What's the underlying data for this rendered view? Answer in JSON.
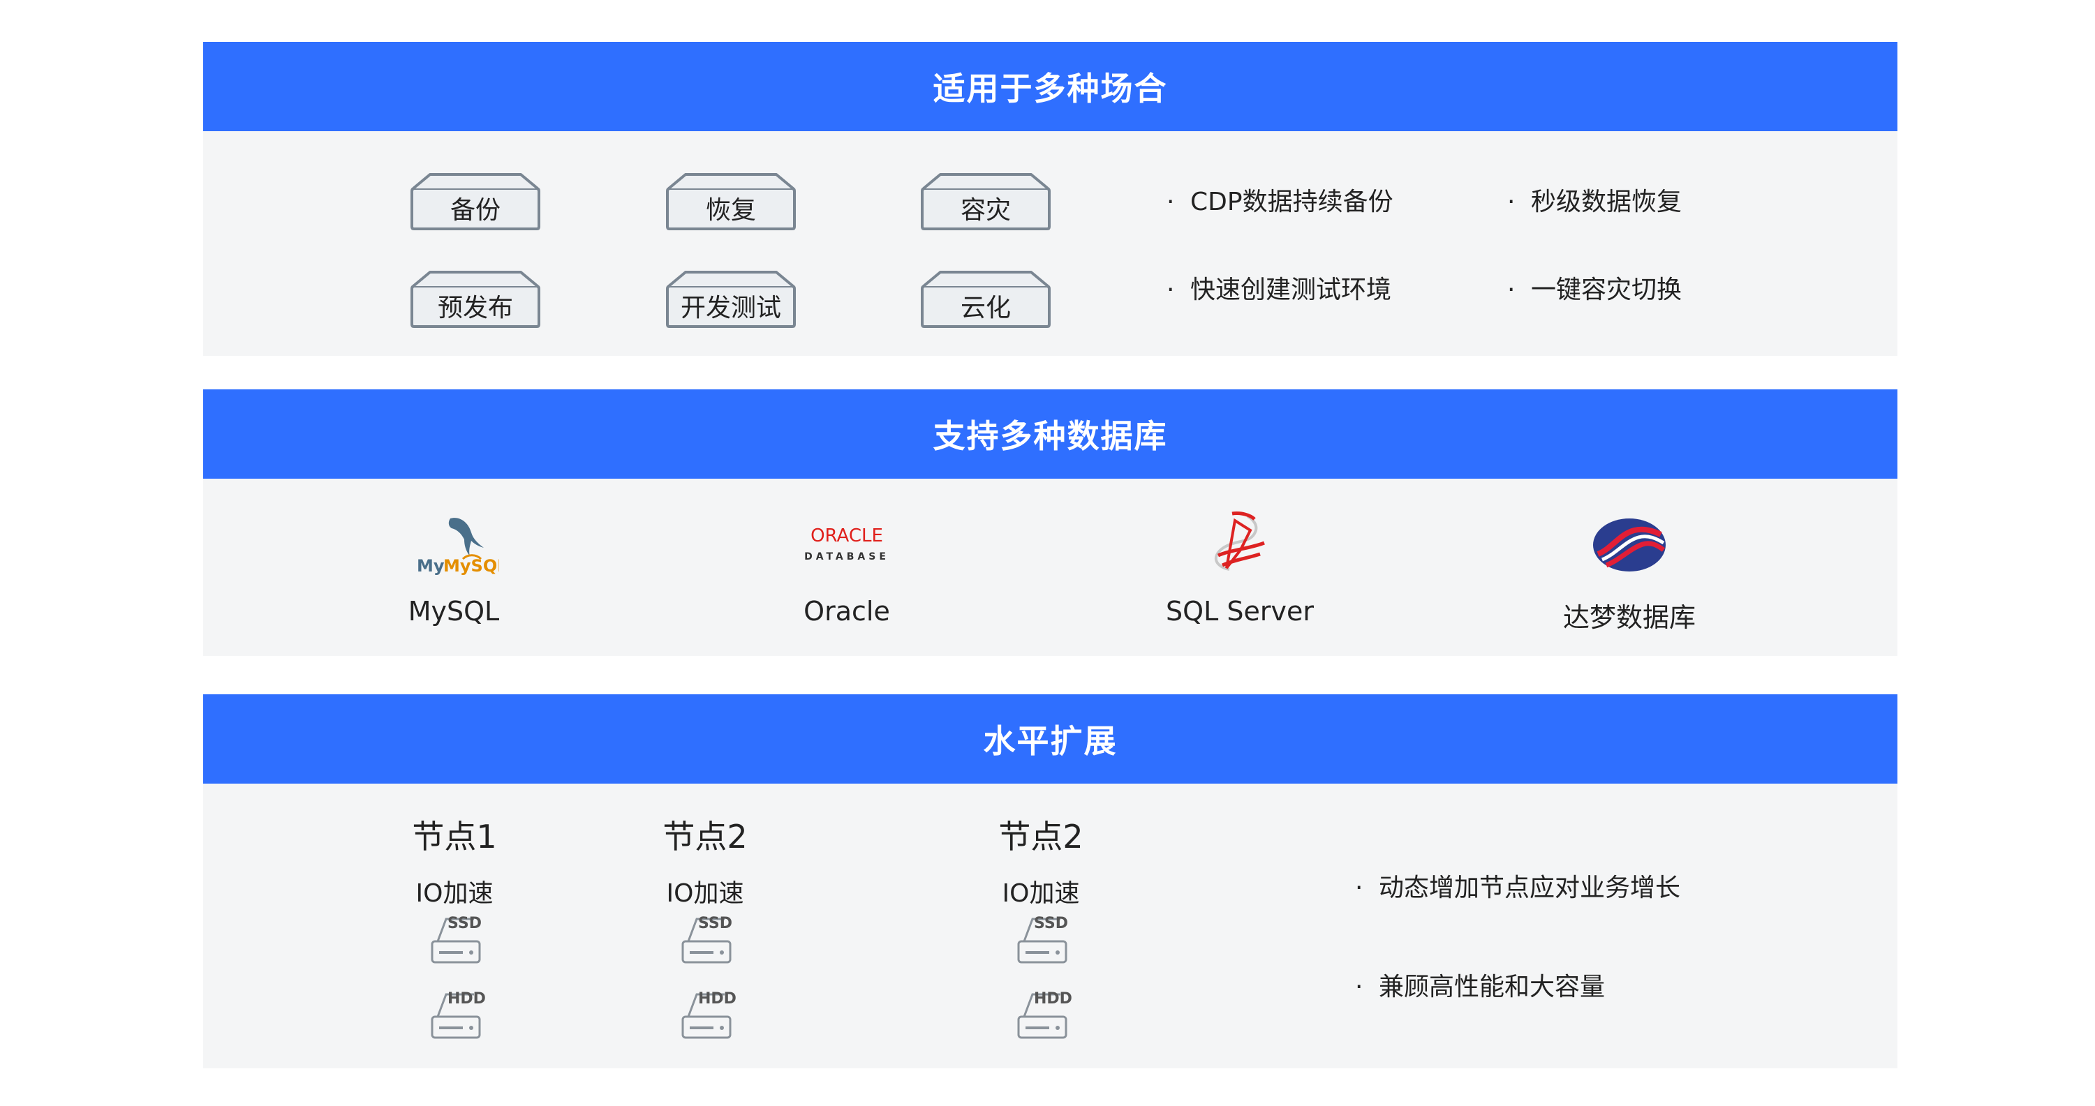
{
  "sections": {
    "scenarios": {
      "title": "适用于多种场合",
      "trays": [
        "备份",
        "恢复",
        "容灾",
        "预发布",
        "开发测试",
        "云化"
      ],
      "bullets": [
        "CDP数据持续备份",
        "秒级数据恢复",
        "快速创建测试环境",
        "一键容灾切换"
      ],
      "bullet_dot": "·"
    },
    "databases": {
      "title": "支持多种数据库",
      "items": [
        {
          "name": "MySQL",
          "logo_icon": "mysql-dolphin-icon",
          "logo_text": "MySQL"
        },
        {
          "name": "Oracle",
          "logo_icon": "oracle-logo-icon",
          "logo_text": "ORACLE",
          "logo_subtext": "DATABASE"
        },
        {
          "name": "SQL Server",
          "logo_icon": "sql-server-logo-icon"
        },
        {
          "name": "达梦数据库",
          "logo_icon": "dameng-logo-icon"
        }
      ]
    },
    "scaling": {
      "title": "水平扩展",
      "nodes": [
        {
          "title": "节点1",
          "sub": "IO加速",
          "drives": [
            "SSD",
            "HDD"
          ]
        },
        {
          "title": "节点2",
          "sub": "IO加速",
          "drives": [
            "SSD",
            "HDD"
          ]
        },
        {
          "title": "节点2",
          "sub": "IO加速",
          "drives": [
            "SSD",
            "HDD"
          ]
        }
      ],
      "bullets": [
        "动态增加节点应对业务增长",
        "兼顾高性能和大容量"
      ],
      "bullet_dot": "·"
    }
  },
  "colors": {
    "band": "#2f6fff",
    "panel": "#f4f5f6",
    "tray_stroke": "#7a8692",
    "tray_fill": "#eceff2"
  }
}
